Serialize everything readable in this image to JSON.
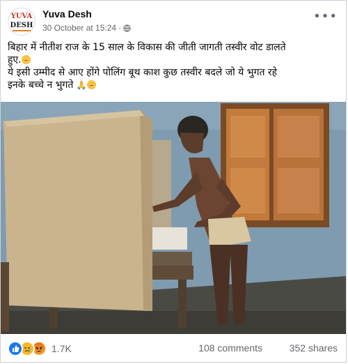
{
  "post": {
    "author": "Yuva Desh",
    "avatar": {
      "line1": "YUVA",
      "line2": "DESH"
    },
    "timestamp": "30 October at 15:24",
    "separator": "·",
    "privacy_icon": "globe-icon",
    "more_icon": "more-options-icon",
    "text_line1": "बिहार में नीतीश राज के 15 साल के विकास की जीती जागती तस्वीर वोट डालते",
    "text_line2": "हुए.",
    "text_line3": "ये इसी उम्मीद से आए होंगे पोलिंग बूथ काश कुछ तस्वीर बदले जो ये भुगत रहे",
    "text_line4": "इनके बच्चे न भुगते"
  },
  "footer": {
    "reaction_icons": [
      "like-icon",
      "sad-icon",
      "angry-icon"
    ],
    "reaction_count": "1.7K",
    "comments": "108 comments",
    "shares": "352 shares"
  },
  "colors": {
    "like": "#1877f2",
    "sad": "#f7b928",
    "angry": "#e9710f",
    "meta_text": "#65676b",
    "wall": "#7c98ad",
    "cardboard": "#c9b48e"
  }
}
